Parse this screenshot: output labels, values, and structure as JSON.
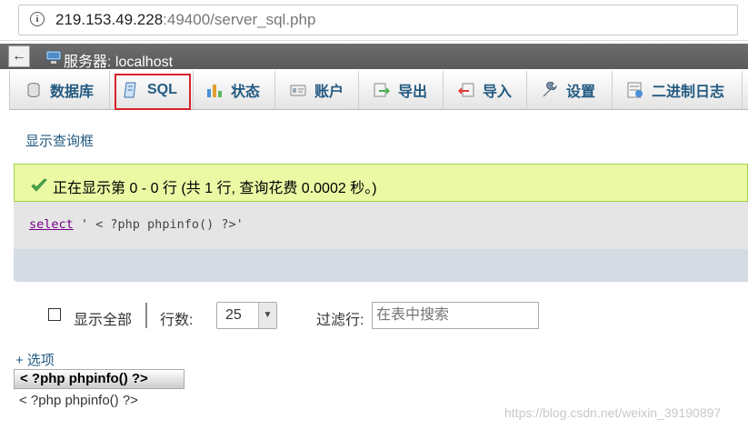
{
  "browser": {
    "url_host": "219.153.49.228",
    "url_rest": ":49400/server_sql.php"
  },
  "server": {
    "back_label": "←",
    "label": "服务器: localhost"
  },
  "tabs": [
    {
      "label": "数据库",
      "icon": "database-icon"
    },
    {
      "label": "SQL",
      "icon": "sql-icon",
      "active": true
    },
    {
      "label": "状态",
      "icon": "status-chart-icon"
    },
    {
      "label": "账户",
      "icon": "accounts-icon"
    },
    {
      "label": "导出",
      "icon": "export-icon"
    },
    {
      "label": "导入",
      "icon": "import-icon"
    },
    {
      "label": "设置",
      "icon": "wrench-icon"
    },
    {
      "label": "二进制日志",
      "icon": "binlog-icon"
    }
  ],
  "query": {
    "show_query_box": "显示查询框",
    "success_message": "正在显示第 0 - 0 行 (共 1 行, 查询花费 0.0002 秒。)",
    "sql_keyword": "select",
    "sql_rest": " ' < ?php phpinfo() ?>'"
  },
  "controls": {
    "show_all_label": "显示全部",
    "rows_label": "行数:",
    "rows_value": "25",
    "filter_label": "过滤行:",
    "filter_placeholder": "在表中搜索"
  },
  "results": {
    "options_link": "+ 选项",
    "column_header": "< ?php phpinfo() ?>",
    "cell_value": "< ?php phpinfo() ?>"
  },
  "watermark": "https://blog.csdn.net/weixin_39190897",
  "colors": {
    "link": "#235a81",
    "success_bg": "#ebf8a4",
    "highlight_border": "#d9232b"
  }
}
